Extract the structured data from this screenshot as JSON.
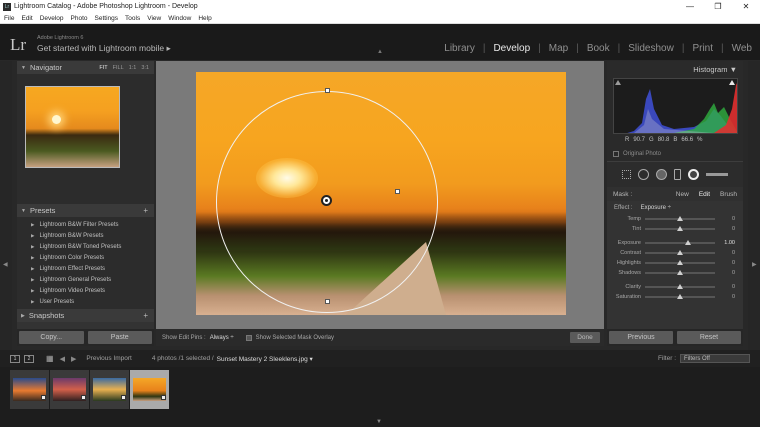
{
  "window": {
    "title": "Lightroom Catalog - Adobe Photoshop Lightroom - Develop",
    "controls": [
      "—",
      "❐",
      "✕"
    ]
  },
  "menu": [
    "File",
    "Edit",
    "Develop",
    "Photo",
    "Settings",
    "Tools",
    "View",
    "Window",
    "Help"
  ],
  "identity": {
    "logo": "Lr",
    "subtitle": "Adobe Lightroom 6",
    "tagline": "Get started with Lightroom mobile ▸"
  },
  "modules": [
    {
      "label": "Library",
      "active": false
    },
    {
      "label": "Develop",
      "active": true
    },
    {
      "label": "Map",
      "active": false
    },
    {
      "label": "Book",
      "active": false
    },
    {
      "label": "Slideshow",
      "active": false
    },
    {
      "label": "Print",
      "active": false
    },
    {
      "label": "Web",
      "active": false
    }
  ],
  "navigator": {
    "title": "Navigator",
    "zoom": [
      "FIT",
      "FILL",
      "1:1",
      "3:1"
    ]
  },
  "presets": {
    "title": "Presets",
    "add": "+",
    "items": [
      "Lightroom B&W Filter Presets",
      "Lightroom B&W Presets",
      "Lightroom B&W Toned Presets",
      "Lightroom Color Presets",
      "Lightroom Effect Presets",
      "Lightroom General Presets",
      "Lightroom Video Presets",
      "User Presets"
    ]
  },
  "snapshots": {
    "title": "Snapshots",
    "add": "+"
  },
  "left_buttons": {
    "copy": "Copy...",
    "paste": "Paste"
  },
  "toolbar": {
    "show_pins_label": "Show Edit Pins :",
    "show_pins_value": "Always ÷",
    "overlay_label": "Show Selected Mask Overlay",
    "done": "Done"
  },
  "histogram": {
    "title": "Histogram",
    "r_label": "R",
    "r_value": "90.7",
    "g_label": "G",
    "g_value": "80.8",
    "b_label": "B",
    "b_value": "66.6",
    "pct": "%",
    "original": "Original Photo"
  },
  "mask": {
    "label": "Mask :",
    "new": "New",
    "edit": "Edit",
    "brush": "Brush"
  },
  "effect": {
    "label": "Effect :",
    "value": "Exposure ÷",
    "sliders": [
      {
        "name": "Temp",
        "value": "0",
        "pos": 0.5
      },
      {
        "name": "Tint",
        "value": "0",
        "pos": 0.5
      },
      {
        "name": "Exposure",
        "value": "1.00",
        "pos": 0.62
      },
      {
        "name": "Contrast",
        "value": "0",
        "pos": 0.5
      },
      {
        "name": "Highlights",
        "value": "0",
        "pos": 0.5
      },
      {
        "name": "Shadows",
        "value": "0",
        "pos": 0.5
      },
      {
        "name": "Clarity",
        "value": "0",
        "pos": 0.5
      },
      {
        "name": "Saturation",
        "value": "0",
        "pos": 0.5
      }
    ]
  },
  "right_buttons": {
    "previous": "Previous",
    "reset": "Reset"
  },
  "filmbar": {
    "page1": "1",
    "page2": "2",
    "source": "Previous Import",
    "count": "4 photos /1 selected /",
    "filename": "Sunset Mastery 2 Sleeklens.jpg ▾",
    "filter_label": "Filter :",
    "filter_value": "Filters Off"
  },
  "colors": {
    "accent": "#e8e8e8",
    "panel": "#333333",
    "sky": "#f5a727"
  }
}
